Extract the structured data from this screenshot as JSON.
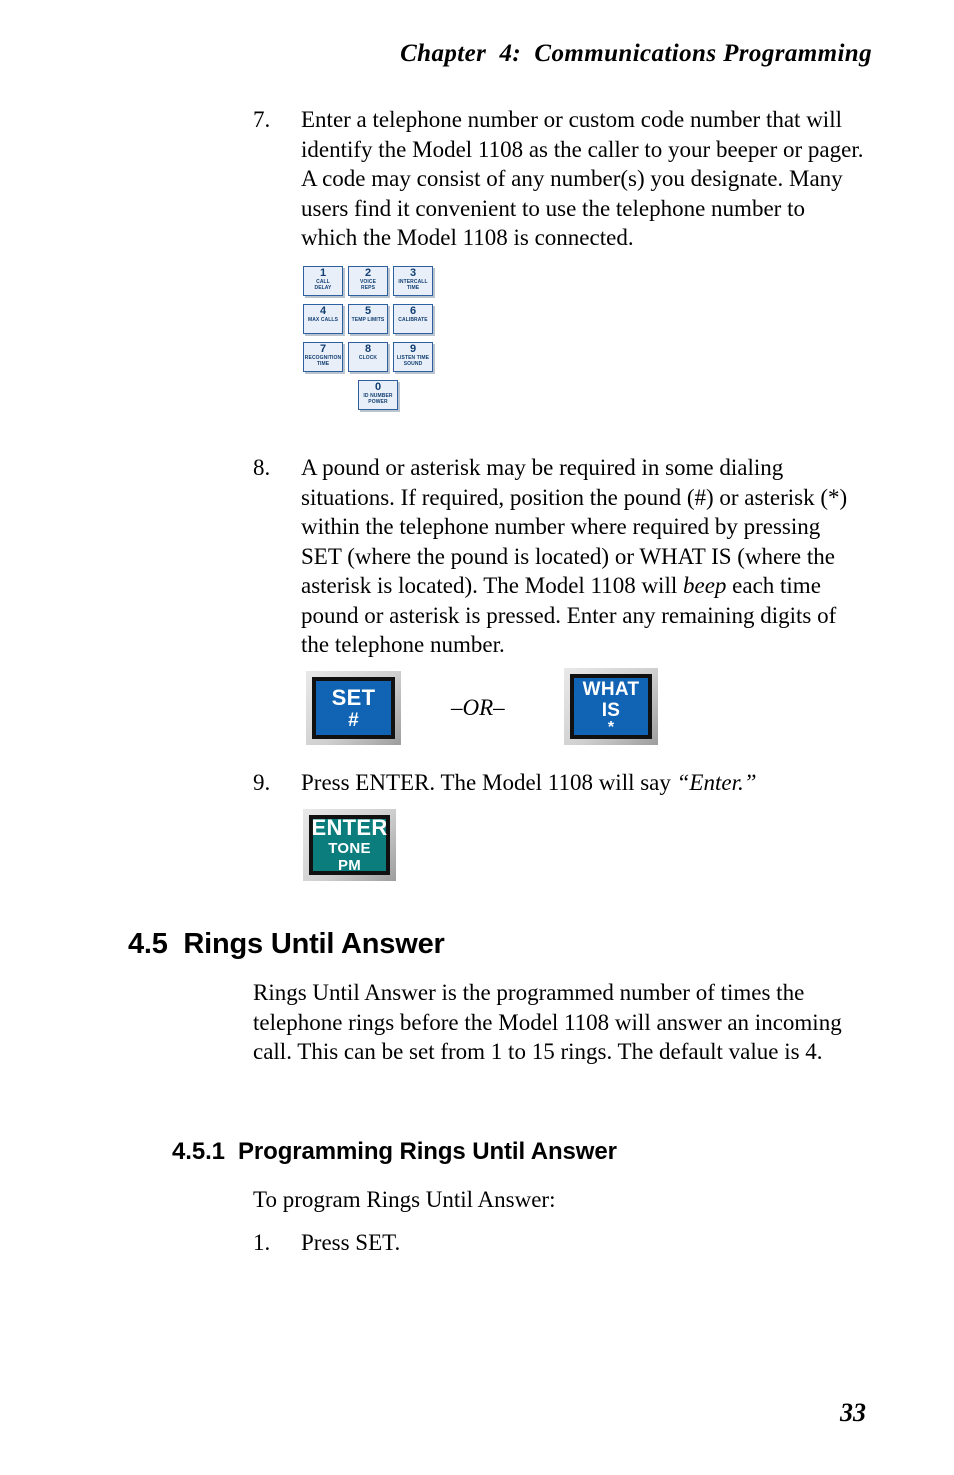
{
  "document": {
    "running_head": "Chapter  4:  Communications Programming",
    "page_number": "33"
  },
  "steps": [
    {
      "number": "7.",
      "text": "Enter a telephone number or custom code number that will identify the Model 1108 as the caller to your beeper or pager. A code may consist of any number(s) you designate. Many users find it convenient to use the telephone number to which the Model 1108 is connected."
    },
    {
      "number": "8.",
      "text_part1": "A pound or asterisk may be required in some dialing situations. If required, position the pound (#) or asterisk (*) within the telephone number where required by pressing SET (where the pound is located) or WHAT IS (where the asterisk is located). The Model 1108 will ",
      "emphasis": "beep",
      "text_part2": " each time pound or asterisk is pressed. Enter any remaining digits of the telephone number."
    },
    {
      "number": "9.",
      "text_part1": "Press ENTER. The Model 1108 will say ",
      "emphasis": "“Enter.”"
    }
  ],
  "keypad": {
    "rows": [
      [
        {
          "digit": "1",
          "line1": "CALL",
          "line2": "DELAY"
        },
        {
          "digit": "2",
          "line1": "VOICE",
          "line2": "REPS"
        },
        {
          "digit": "3",
          "line1": "INTERCALL",
          "line2": "TIME"
        }
      ],
      [
        {
          "digit": "4",
          "line1": "MAX CALLS",
          "line2": ""
        },
        {
          "digit": "5",
          "line1": "TEMP LIMITS",
          "line2": ""
        },
        {
          "digit": "6",
          "line1": "CALIBRATE",
          "line2": ""
        }
      ],
      [
        {
          "digit": "7",
          "line1": "RECOGNITION",
          "line2": "TIME"
        },
        {
          "digit": "8",
          "line1": "CLOCK",
          "line2": ""
        },
        {
          "digit": "9",
          "line1": "LISTEN TIME",
          "line2": "SOUND"
        }
      ],
      [
        {
          "digit": "0",
          "line1": "ID NUMBER",
          "line2": "POWER"
        }
      ]
    ]
  },
  "buttons": {
    "set": {
      "line1": "SET",
      "line2": "#",
      "color": "#1164b4"
    },
    "or_separator": "–OR–",
    "what_is": {
      "line1": "WHAT",
      "line2": "IS",
      "line3": "*",
      "color": "#1164b4"
    },
    "enter": {
      "line1": "ENTER",
      "line2": "TONE",
      "line3": "PM",
      "color": "#0b7d7d"
    }
  },
  "sections": {
    "heading_4_5": "4.5  Rings Until Answer",
    "body_4_5": "Rings Until Answer is the programmed number of times the telephone rings before the Model 1108 will answer an incoming call. This can be set from 1 to 15 rings. The default value is 4.",
    "heading_4_5_1": "4.5.1  Programming Rings Until Answer",
    "intro_4_5_1": "To program Rings Until Answer:",
    "step_1": {
      "number": "1.",
      "text": "Press SET."
    }
  }
}
